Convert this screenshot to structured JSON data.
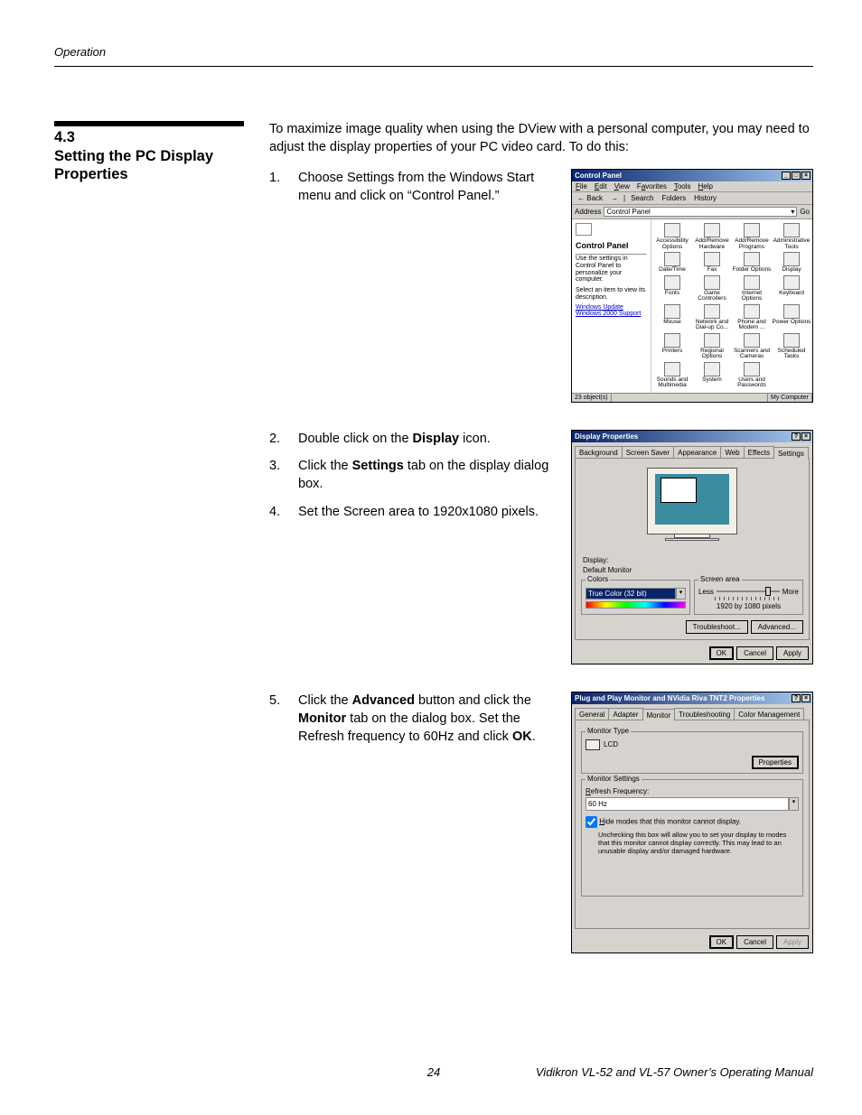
{
  "running_head": "Operation",
  "section": {
    "number": "4.3",
    "title": "Setting the PC Display Properties"
  },
  "intro": "To maximize image quality when using the DView with a personal computer, you may need to adjust the display properties of your PC video card. To do this:",
  "steps": {
    "s1": {
      "num": "1.",
      "a": "Choose Settings from the Windows Start menu and click on “Control Panel.”"
    },
    "s2": {
      "num": "2.",
      "a": "Double click on the ",
      "b": "Display",
      "c": " icon."
    },
    "s3": {
      "num": "3.",
      "a": "Click the ",
      "b": "Settings",
      "c": " tab on the display dialog box."
    },
    "s4": {
      "num": "4.",
      "a": "Set the Screen area to 1920x1080 pixels."
    },
    "s5": {
      "num": "5.",
      "a": "Click the ",
      "b": "Advanced",
      "c": " button and click the ",
      "d": "Monitor",
      "e": " tab on the dialog box. Set the Refresh frequency to 60Hz and click ",
      "f": "OK",
      "g": "."
    }
  },
  "fig1": {
    "title": "Control Panel",
    "menus": {
      "file": "File",
      "edit": "Edit",
      "view": "View",
      "fav": "Favorites",
      "tools": "Tools",
      "help": "Help"
    },
    "tb": {
      "back": "Back",
      "search": "Search",
      "folders": "Folders",
      "history": "History"
    },
    "addr_label": "Address",
    "addr_value": "Control Panel",
    "go": "Go",
    "left": {
      "title": "Control Panel",
      "desc": "Use the settings in Control Panel to personalize your computer.",
      "desc2": "Select an item to view its description.",
      "link1": "Windows Update",
      "link2": "Windows 2000 Support"
    },
    "icons": [
      "Accessibility Options",
      "Add/Remove Hardware",
      "Add/Remove Programs",
      "Administrative Tools",
      "Date/Time",
      "Fax",
      "Folder Options",
      "Display",
      "Fonts",
      "Game Controllers",
      "Internet Options",
      "Keyboard",
      "Mouse",
      "Network and Dial-up Co...",
      "Phone and Modem ...",
      "Power Options",
      "Printers",
      "Regional Options",
      "Scanners and Cameras",
      "Scheduled Tasks",
      "Sounds and Multimedia",
      "System",
      "Users and Passwords",
      ""
    ],
    "status_left": "23 object(s)",
    "status_right": "My Computer"
  },
  "fig2": {
    "title": "Display Properties",
    "tabs": {
      "bg": "Background",
      "ss": "Screen Saver",
      "ap": "Appearance",
      "web": "Web",
      "fx": "Effects",
      "set": "Settings"
    },
    "display_label": "Display:",
    "display_value": "Default Monitor",
    "colors_legend": "Colors",
    "colors_value": "True Color (32 bit)",
    "area_legend": "Screen area",
    "less": "Less",
    "more": "More",
    "res": "1920 by 1080 pixels",
    "troubleshoot": "Troubleshoot...",
    "advanced": "Advanced...",
    "ok": "OK",
    "cancel": "Cancel",
    "apply": "Apply"
  },
  "fig3": {
    "title": "Plug and Play Monitor and NVidia Riva TNT2 Properties",
    "tabs": {
      "gen": "General",
      "ad": "Adapter",
      "mon": "Monitor",
      "tb": "Troubleshooting",
      "cm": "Color Management"
    },
    "montype_legend": "Monitor Type",
    "montype_value": "LCD",
    "properties": "Properties",
    "monset_legend": "Monitor Settings",
    "refresh_label": "Refresh Frequency:",
    "refresh_value": "60 Hz",
    "hide_chk": "Hide modes that this monitor cannot display.",
    "note": "Unchecking this box will allow you to set your display to modes that this monitor cannot display correctly. This may lead to an unusable display and/or damaged hardware.",
    "ok": "OK",
    "cancel": "Cancel",
    "apply": "Apply"
  },
  "footer": {
    "page": "24",
    "title": "Vidikron VL-52 and VL-57 Owner’s Operating Manual"
  }
}
